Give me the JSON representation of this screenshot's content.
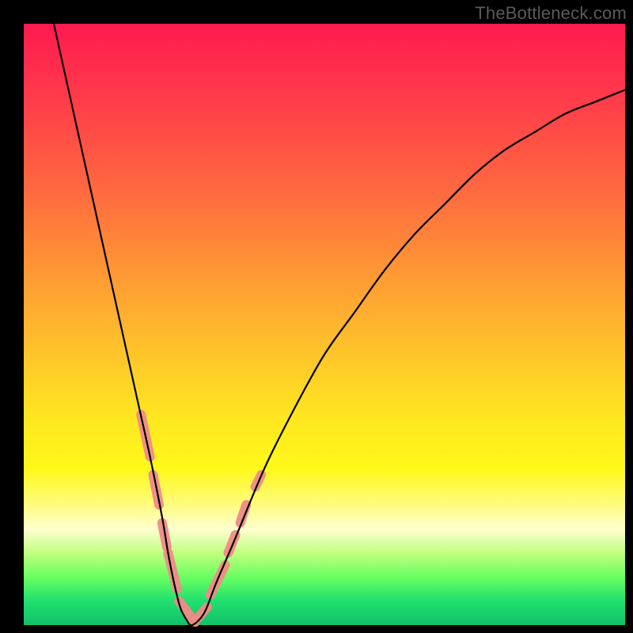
{
  "watermark": "TheBottleneck.com",
  "chart_data": {
    "type": "line",
    "title": "",
    "xlabel": "",
    "ylabel": "",
    "xlim": [
      0,
      100
    ],
    "ylim": [
      0,
      100
    ],
    "background_gradient": {
      "top": "#ff1a4f",
      "upper_mid": "#ff9a34",
      "mid": "#ffe820",
      "lower_mid": "#fffc80",
      "bottom": "#12c068"
    },
    "series": [
      {
        "name": "bottleneck-curve",
        "color": "#000000",
        "x": [
          5,
          7,
          9,
          11,
          13,
          15,
          17,
          19,
          21,
          23,
          24,
          25,
          26,
          27,
          28,
          30,
          32,
          35,
          40,
          45,
          50,
          55,
          60,
          65,
          70,
          75,
          80,
          85,
          90,
          95,
          100
        ],
        "y": [
          100,
          91,
          82,
          73,
          64,
          55,
          46,
          37,
          28,
          18,
          12,
          7,
          3,
          1,
          0,
          2,
          7,
          14,
          26,
          36,
          45,
          52,
          59,
          65,
          70,
          75,
          79,
          82,
          85,
          87,
          89
        ]
      }
    ],
    "markers": {
      "name": "highlight-segments",
      "color": "#f08c88",
      "stroke_width": 12,
      "segments": [
        {
          "x": [
            19.5,
            21.0
          ],
          "y": [
            35,
            28
          ]
        },
        {
          "x": [
            21.5,
            22.5
          ],
          "y": [
            25,
            20
          ]
        },
        {
          "x": [
            23.0,
            23.8
          ],
          "y": [
            17,
            13
          ]
        },
        {
          "x": [
            24.0,
            25.5
          ],
          "y": [
            12,
            6
          ]
        },
        {
          "x": [
            25.8,
            28.5
          ],
          "y": [
            4,
            0.5
          ]
        },
        {
          "x": [
            28.8,
            30.5
          ],
          "y": [
            1,
            3
          ]
        },
        {
          "x": [
            31.0,
            33.5
          ],
          "y": [
            5,
            10
          ]
        },
        {
          "x": [
            34.0,
            35.2
          ],
          "y": [
            12,
            15
          ]
        },
        {
          "x": [
            36.0,
            37.0
          ],
          "y": [
            17,
            20
          ]
        },
        {
          "x": [
            38.5,
            39.5
          ],
          "y": [
            23,
            25
          ]
        }
      ]
    }
  }
}
